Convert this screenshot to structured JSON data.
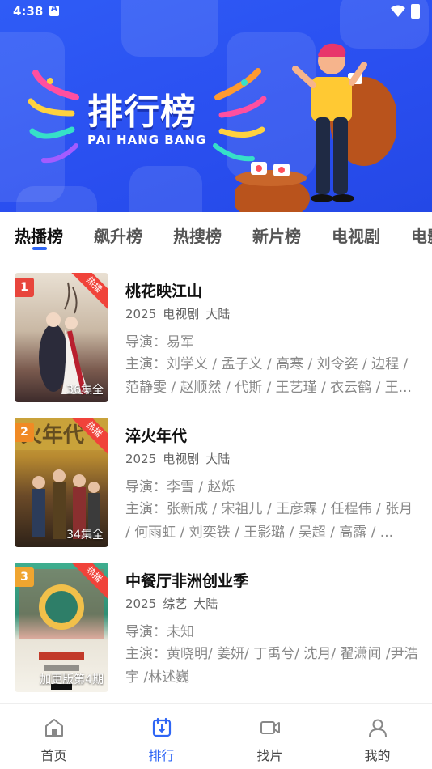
{
  "status_bar": {
    "time": "4:38"
  },
  "banner": {
    "title": "排行榜",
    "subtitle": "PAI HANG BANG"
  },
  "tabs": [
    {
      "label": "热播榜",
      "active": true
    },
    {
      "label": "飙升榜",
      "active": false
    },
    {
      "label": "热搜榜",
      "active": false
    },
    {
      "label": "新片榜",
      "active": false
    },
    {
      "label": "电视剧",
      "active": false
    },
    {
      "label": "电影",
      "active": false
    }
  ],
  "items": [
    {
      "rank": "1",
      "badge": "热播",
      "episodes": "36集全",
      "title": "桃花映江山",
      "year": "2025",
      "genre": "电视剧",
      "region": "大陆",
      "director": "导演：易军",
      "cast": "主演：刘学义 / 孟子义 / 高寒 / 刘令姿 / 边程 / 范静雯 / 赵顺然 / 代斯 / 王艺瑾 / 衣云鹤 / 王...",
      "rank_color": "#e8453c"
    },
    {
      "rank": "2",
      "badge": "热播",
      "episodes": "34集全",
      "title": "淬火年代",
      "year": "2025",
      "genre": "电视剧",
      "region": "大陆",
      "director": "导演：李雪 / 赵烁",
      "cast": "主演：张新成 / 宋祖儿 / 王彦霖 / 任程伟 / 张月 / 何雨虹 / 刘奕铁 / 王影璐 / 吴超 / 高露 / ...",
      "rank_color": "#f08a24"
    },
    {
      "rank": "3",
      "badge": "热播",
      "episodes": "加更版第4期",
      "title": "中餐厅非洲创业季",
      "year": "2025",
      "genre": "综艺",
      "region": "大陆",
      "director": "导演：未知",
      "cast": "主演：黄晓明/ 姜妍/ 丁禹兮/ 沈月/ 翟潇闻 /尹浩宇 /林述巍",
      "rank_color": "#f0a530"
    }
  ],
  "bottom_nav": [
    {
      "label": "首页",
      "icon": "home-icon",
      "active": false
    },
    {
      "label": "排行",
      "icon": "ranking-icon",
      "active": true
    },
    {
      "label": "找片",
      "icon": "video-icon",
      "active": false
    },
    {
      "label": "我的",
      "icon": "profile-icon",
      "active": false
    }
  ],
  "colors": {
    "accent": "#2f66f5",
    "banner_bg": "#2a4ff0",
    "hot_badge": "#f0433a"
  }
}
